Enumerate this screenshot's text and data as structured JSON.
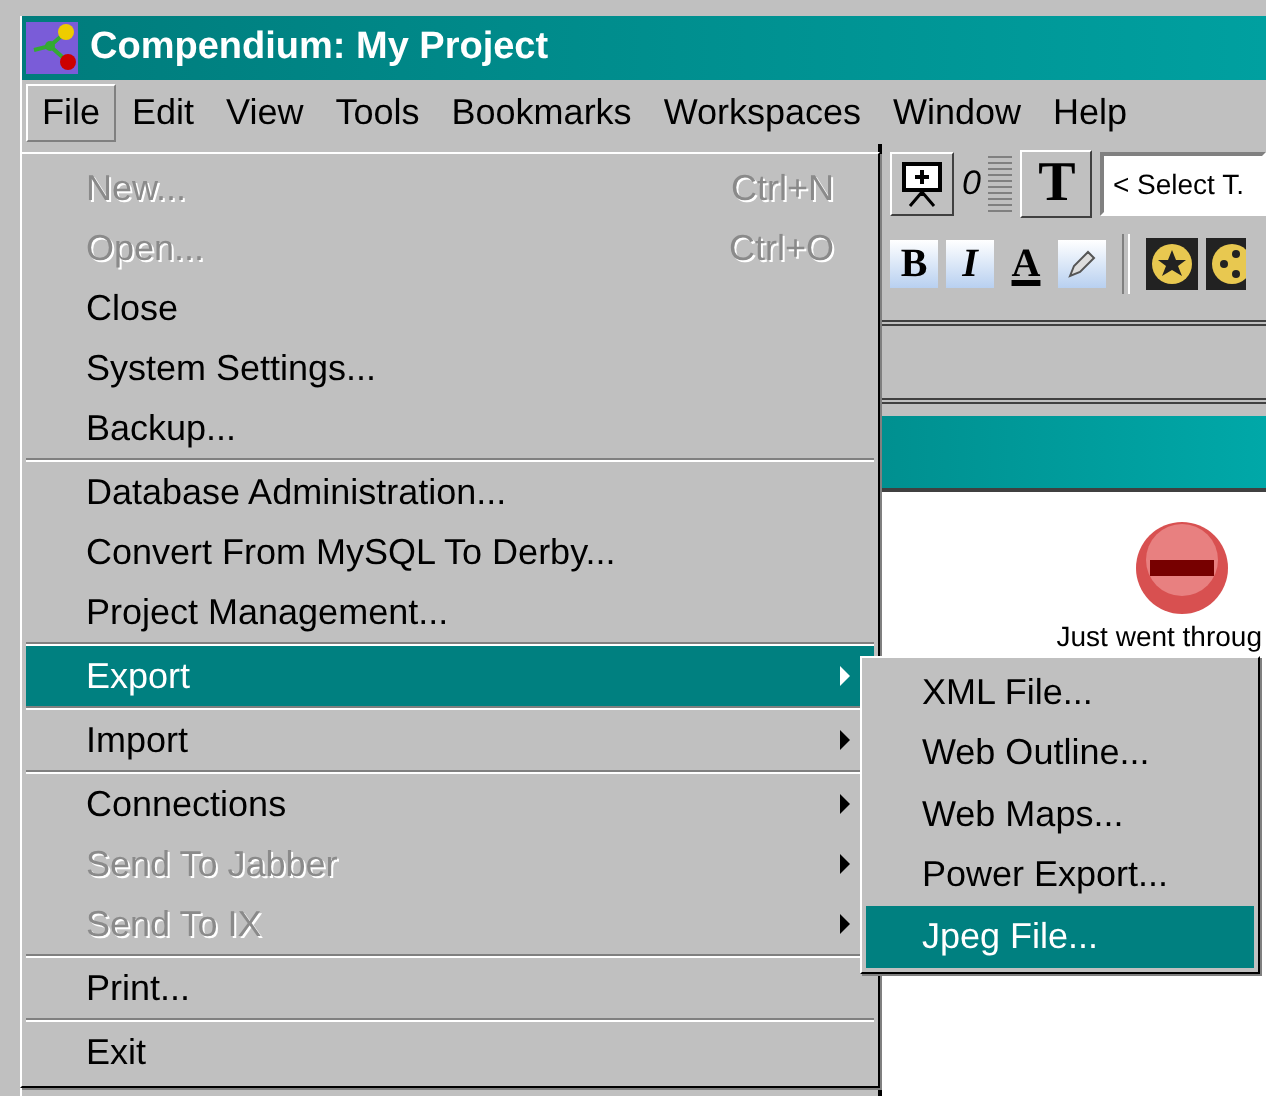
{
  "window": {
    "title": "Compendium: My Project"
  },
  "menubar": [
    {
      "label": "File",
      "selected": true
    },
    {
      "label": "Edit",
      "selected": false
    },
    {
      "label": "View",
      "selected": false
    },
    {
      "label": "Tools",
      "selected": false
    },
    {
      "label": "Bookmarks",
      "selected": false
    },
    {
      "label": "Workspaces",
      "selected": false
    },
    {
      "label": "Window",
      "selected": false
    },
    {
      "label": "Help",
      "selected": false
    }
  ],
  "toolbar": {
    "counter": "0",
    "text_button": "T",
    "type_select": "< Select T.",
    "format_buttons": [
      {
        "kind": "bold",
        "label": "B"
      },
      {
        "kind": "italic",
        "label": "I"
      },
      {
        "kind": "color",
        "label": "A"
      },
      {
        "kind": "pencil"
      }
    ]
  },
  "view": {
    "message": "Just went throug"
  },
  "file_menu": [
    {
      "kind": "item",
      "label": "New...",
      "shortcut": "Ctrl+N",
      "disabled": true,
      "selected": false,
      "submenu": false
    },
    {
      "kind": "item",
      "label": "Open...",
      "shortcut": "Ctrl+O",
      "disabled": true,
      "selected": false,
      "submenu": false
    },
    {
      "kind": "item",
      "label": "Close",
      "disabled": false,
      "selected": false,
      "submenu": false
    },
    {
      "kind": "item",
      "label": "System Settings...",
      "disabled": false,
      "selected": false,
      "submenu": false
    },
    {
      "kind": "item",
      "label": "Backup...",
      "disabled": false,
      "selected": false,
      "submenu": false
    },
    {
      "kind": "separator"
    },
    {
      "kind": "item",
      "label": "Database Administration...",
      "disabled": false,
      "selected": false,
      "submenu": false
    },
    {
      "kind": "item",
      "label": "Convert From MySQL To Derby...",
      "disabled": false,
      "selected": false,
      "submenu": false
    },
    {
      "kind": "item",
      "label": "Project Management...",
      "disabled": false,
      "selected": false,
      "submenu": false
    },
    {
      "kind": "separator"
    },
    {
      "kind": "item",
      "label": "Export",
      "disabled": false,
      "selected": true,
      "submenu": true
    },
    {
      "kind": "separator"
    },
    {
      "kind": "item",
      "label": "Import",
      "disabled": false,
      "selected": false,
      "submenu": true
    },
    {
      "kind": "separator"
    },
    {
      "kind": "item",
      "label": "Connections",
      "disabled": false,
      "selected": false,
      "submenu": true
    },
    {
      "kind": "item",
      "label": "Send To Jabber",
      "disabled": true,
      "selected": false,
      "submenu": true
    },
    {
      "kind": "item",
      "label": "Send To IX",
      "disabled": true,
      "selected": false,
      "submenu": true
    },
    {
      "kind": "separator"
    },
    {
      "kind": "item",
      "label": "Print...",
      "disabled": false,
      "selected": false,
      "submenu": false
    },
    {
      "kind": "separator"
    },
    {
      "kind": "item",
      "label": "Exit",
      "disabled": false,
      "selected": false,
      "submenu": false
    }
  ],
  "export_menu": [
    {
      "label": "XML File...",
      "selected": false
    },
    {
      "label": "Web Outline...",
      "selected": false
    },
    {
      "label": "Web Maps...",
      "selected": false
    },
    {
      "label": "Power Export...",
      "selected": false
    },
    {
      "label": "Jpeg File...",
      "selected": true
    }
  ]
}
